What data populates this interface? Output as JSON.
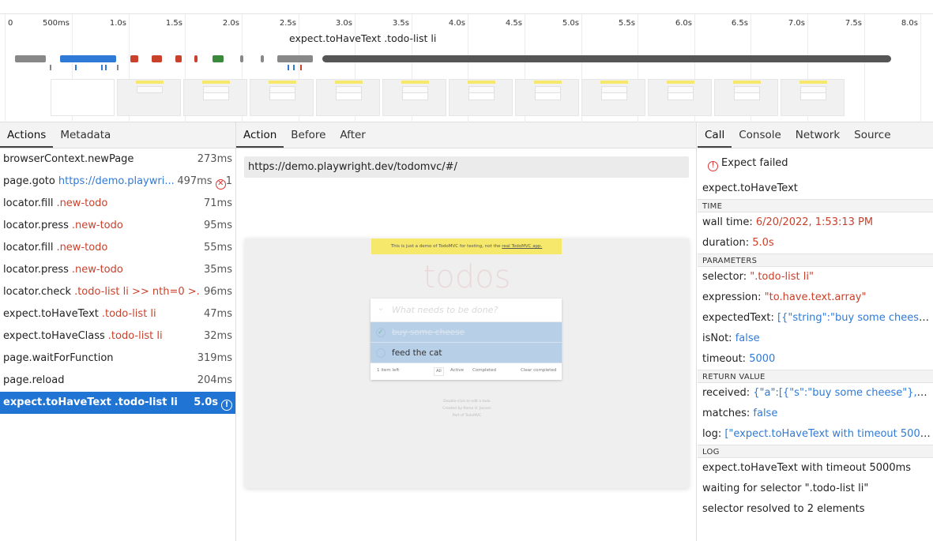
{
  "timeline": {
    "ticks": [
      "0",
      "500ms",
      "1.0s",
      "1.5s",
      "2.0s",
      "2.5s",
      "3.0s",
      "3.5s",
      "4.0s",
      "4.5s",
      "5.0s",
      "5.5s",
      "6.0s",
      "6.5s",
      "7.0s",
      "7.5s",
      "8.0s"
    ],
    "hover_title": "expect.toHaveText .todo-list li"
  },
  "left": {
    "tabs": [
      "Actions",
      "Metadata"
    ],
    "actions": [
      {
        "name": "browserContext.newPage",
        "selector": "",
        "duration": "273ms"
      },
      {
        "name": "page.goto",
        "link": "https://demo.playwri...",
        "duration": "497ms",
        "errors": "1"
      },
      {
        "name": "locator.fill",
        "selector": ".new-todo",
        "duration": "71ms"
      },
      {
        "name": "locator.press",
        "selector": ".new-todo",
        "duration": "95ms"
      },
      {
        "name": "locator.fill",
        "selector": ".new-todo",
        "duration": "55ms"
      },
      {
        "name": "locator.press",
        "selector": ".new-todo",
        "duration": "35ms"
      },
      {
        "name": "locator.check",
        "selector": ".todo-list li >> nth=0 >...",
        "duration": "96ms"
      },
      {
        "name": "expect.toHaveText",
        "selector": ".todo-list li",
        "duration": "47ms"
      },
      {
        "name": "expect.toHaveClass",
        "selector": ".todo-list li",
        "duration": "32ms"
      },
      {
        "name": "page.waitForFunction",
        "selector": "",
        "duration": "319ms"
      },
      {
        "name": "page.reload",
        "selector": "",
        "duration": "204ms"
      },
      {
        "name": "expect.toHaveText",
        "selector": ".todo-list li",
        "duration": "5.0s",
        "selected": true
      }
    ]
  },
  "middle": {
    "tabs": [
      "Action",
      "Before",
      "After"
    ],
    "url": "https://demo.playwright.dev/todomvc/#/",
    "snapshot": {
      "banner_text": "This is just a demo of TodoMVC for testing, not the",
      "banner_link": "real TodoMVC app.",
      "title": "todos",
      "placeholder": "What needs to be done?",
      "items": [
        {
          "text": "buy some cheese",
          "completed": true
        },
        {
          "text": "feed the cat",
          "completed": false
        }
      ],
      "footer": {
        "count": "1 item left",
        "all": "All",
        "active": "Active",
        "completed": "Completed",
        "clear": "Clear completed"
      },
      "info": [
        "Double-click to edit a todo",
        "Created by Remo H. Jansen",
        "Part of TodoMVC"
      ]
    }
  },
  "right": {
    "tabs": [
      "Call",
      "Console",
      "Network",
      "Source"
    ],
    "status": "Expect failed",
    "call_name": "expect.toHaveText",
    "sections": {
      "time": "TIME",
      "parameters": "PARAMETERS",
      "return_value": "RETURN VALUE",
      "log": "LOG"
    },
    "time": {
      "wall_time_label": "wall time:",
      "wall_time": "6/20/2022, 1:53:13 PM",
      "duration_label": "duration:",
      "duration": "5.0s"
    },
    "parameters": {
      "selector_label": "selector:",
      "selector": "\".todo-list li\"",
      "expression_label": "expression:",
      "expression": "\"to.have.text.array\"",
      "expectedText_label": "expectedText:",
      "expectedText": "[{\"string\":\"buy some cheese\",...",
      "isNot_label": "isNot:",
      "isNot": "false",
      "timeout_label": "timeout:",
      "timeout": "5000"
    },
    "return_value": {
      "received_label": "received:",
      "received": "{\"a\":[{\"s\":\"buy some cheese\"},{\"s\":\"...",
      "matches_label": "matches:",
      "matches": "false",
      "log_label": "log:",
      "log": "[\"expect.toHaveText with timeout 5000..."
    },
    "log": [
      "expect.toHaveText with timeout 5000ms",
      "waiting for selector \".todo-list li\"",
      "selector resolved to 2 elements"
    ]
  }
}
